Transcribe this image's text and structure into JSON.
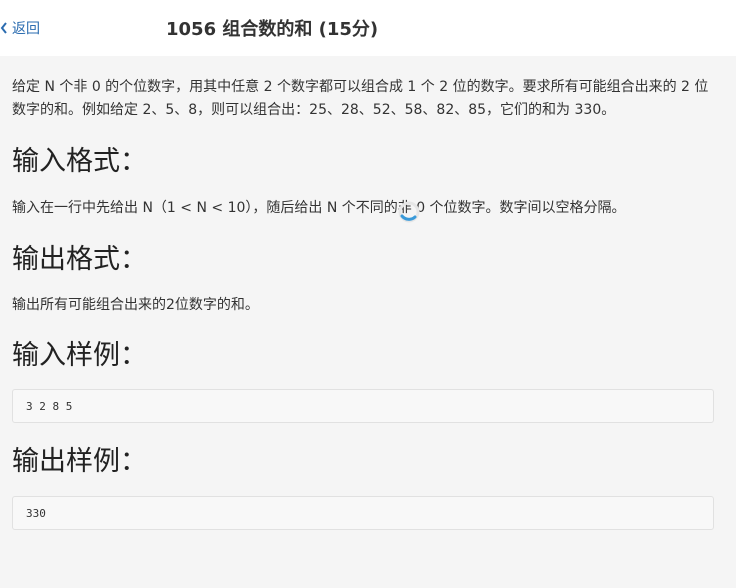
{
  "header": {
    "back_label": "返回",
    "title": "1056 组合数的和 (15分)"
  },
  "problem": {
    "description": "给定 N 个非 0 的个位数字，用其中任意 2 个数字都可以组合成 1 个 2 位的数字。要求所有可能组合出来的 2 位数字的和。例如给定 2、5、8，则可以组合出：25、28、52、58、82、85，它们的和为 330。",
    "input_heading": "输入格式：",
    "input_text": "输入在一行中先给出 N（1 < N < 10），随后给出 N 个不同的非 0 个位数字。数字间以空格分隔。",
    "output_heading": "输出格式：",
    "output_text": "输出所有可能组合出来的2位数字的和。",
    "sample_input_heading": "输入样例：",
    "sample_input": "3 2 8 5",
    "sample_output_heading": "输出样例：",
    "sample_output": "330"
  },
  "icons": {
    "back": "chevron-left-icon",
    "loading": "loading-spinner-icon"
  },
  "colors": {
    "link": "#2b6cb0",
    "spinner": "#3a9ad9"
  }
}
